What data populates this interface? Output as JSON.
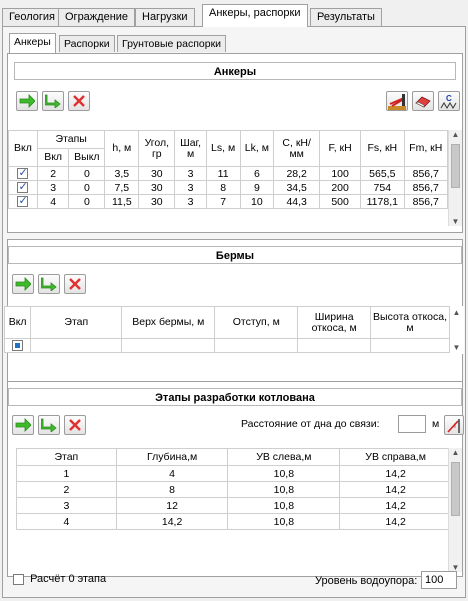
{
  "tabs": [
    "Геология",
    "Ограждение",
    "Нагрузки",
    "Анкеры, распорки",
    "Результаты"
  ],
  "subtabs": [
    "Анкеры",
    "Распорки",
    "Грунтовые распорки"
  ],
  "anchors": {
    "title": "Анкеры",
    "headers": {
      "vkl": "Вкл",
      "etapy": "Этапы",
      "vkl2": "Вкл",
      "vykl": "Выкл",
      "h": "h, м",
      "ugol": "Угол, гр",
      "shag": "Шаг, м",
      "ls": "Ls, м",
      "lk": "Lk, м",
      "c": "C, кН/мм",
      "f": "F, кН",
      "fs": "Fs, кН",
      "fm": "Fm, кН"
    },
    "rows": [
      {
        "checked": true,
        "vkl": "2",
        "vykl": "0",
        "h": "3,5",
        "ugol": "30",
        "shag": "3",
        "ls": "11",
        "lk": "6",
        "c": "28,2",
        "f": "100",
        "fs": "565,5",
        "fm": "856,7"
      },
      {
        "checked": true,
        "vkl": "3",
        "vykl": "0",
        "h": "7,5",
        "ugol": "30",
        "shag": "3",
        "ls": "8",
        "lk": "9",
        "c": "34,5",
        "f": "200",
        "fs": "754",
        "fm": "856,7"
      },
      {
        "checked": true,
        "vkl": "4",
        "vykl": "0",
        "h": "11,5",
        "ugol": "30",
        "shag": "3",
        "ls": "7",
        "lk": "10",
        "c": "44,3",
        "f": "500",
        "fs": "1178,1",
        "fm": "856,7"
      }
    ]
  },
  "berms": {
    "title": "Бермы",
    "headers": {
      "vkl": "Вкл",
      "etap": "Этап",
      "verh": "Верх бермы, м",
      "otstup": "Отступ, м",
      "shirina": "Ширина откоса, м",
      "vysota": "Высота откоса, м"
    }
  },
  "stages": {
    "title": "Этапы разработки котлована",
    "distance_label": "Расстояние от дна до связи:",
    "distance_value": "",
    "distance_unit": "м",
    "headers": {
      "etap": "Этап",
      "glubina": "Глубина,м",
      "uv_left": "УВ слева,м",
      "uv_right": "УВ справа,м"
    },
    "rows": [
      {
        "etap": "1",
        "glubina": "4",
        "uv_left": "10,8",
        "uv_right": "14,2"
      },
      {
        "etap": "2",
        "glubina": "8",
        "uv_left": "10,8",
        "uv_right": "14,2"
      },
      {
        "etap": "3",
        "glubina": "12",
        "uv_left": "10,8",
        "uv_right": "14,2"
      },
      {
        "etap": "4",
        "glubina": "14,2",
        "uv_left": "10,8",
        "uv_right": "14,2"
      }
    ]
  },
  "footer": {
    "calc_zero_label": "Расчёт 0 этапа",
    "calc_zero_checked": false,
    "water_label": "Уровень водоупора:",
    "water_value": "100"
  }
}
